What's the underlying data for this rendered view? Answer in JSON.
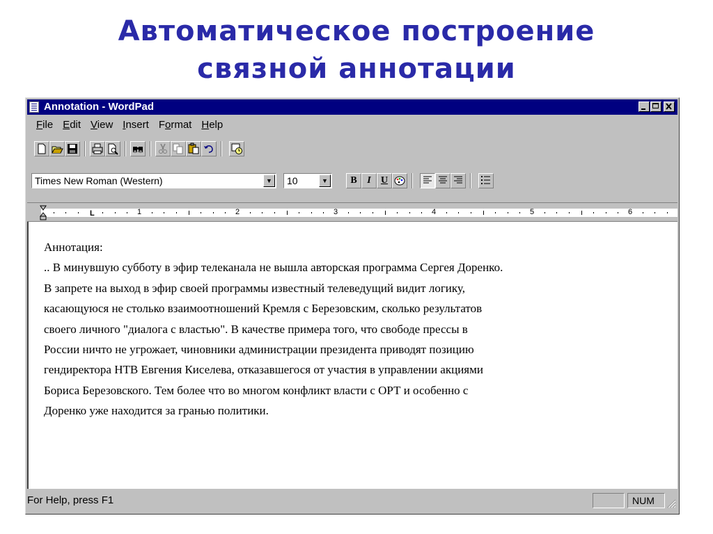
{
  "slide": {
    "title_line1": "Автоматическое построение",
    "title_line2": "связной аннотации"
  },
  "window": {
    "title": "Annotation - WordPad",
    "controls": {
      "minimize": "_",
      "maximize": "□",
      "close": "×"
    }
  },
  "menu": [
    {
      "ul": "F",
      "rest": "ile"
    },
    {
      "ul": "E",
      "rest": "dit"
    },
    {
      "ul": "V",
      "rest": "iew"
    },
    {
      "ul": "I",
      "rest": "nsert"
    },
    {
      "pre": "F",
      "ul": "o",
      "rest": "rmat"
    },
    {
      "ul": "H",
      "rest": "elp"
    }
  ],
  "toolbar": {
    "icons": [
      "new-icon",
      "open-icon",
      "save-icon",
      "print-icon",
      "print-preview-icon",
      "find-icon",
      "cut-icon",
      "copy-icon",
      "paste-icon",
      "undo-icon",
      "insert-date-time-icon"
    ]
  },
  "format": {
    "font": "Times New Roman (Western)",
    "size": "10",
    "bold": "B",
    "italic": "I",
    "underline": "U"
  },
  "ruler": {
    "numbers": [
      "1",
      "2",
      "3",
      "4",
      "5",
      "6"
    ]
  },
  "document": {
    "lines": [
      "Аннотация:",
      ".. В минувшую субботу в эфир телеканала не вышла авторская программа Сергея Доренко.",
      "В запрете на выход в эфир своей программы известный телеведущий видит логику,",
      "касающуюся не столько взаимоотношений Кремля с Березовским, сколько результатов",
      "своего личного \"диалога с властью\". В качестве примера того, что свободе прессы в",
      "России ничто не угрожает, чиновники администрации президента приводят позицию",
      "гендиректора НТВ Евгения Киселева, отказавшегося от участия в управлении акциями",
      "Бориса Березовского. Тем более что во многом конфликт власти с ОРТ и особенно с",
      "Доренко уже находится за гранью политики."
    ]
  },
  "status": {
    "help": "For Help, press F1",
    "num": "NUM"
  },
  "colors": {
    "title_text": "#2a2aa8",
    "titlebar": "#000080",
    "chrome": "#c0c0c0"
  }
}
